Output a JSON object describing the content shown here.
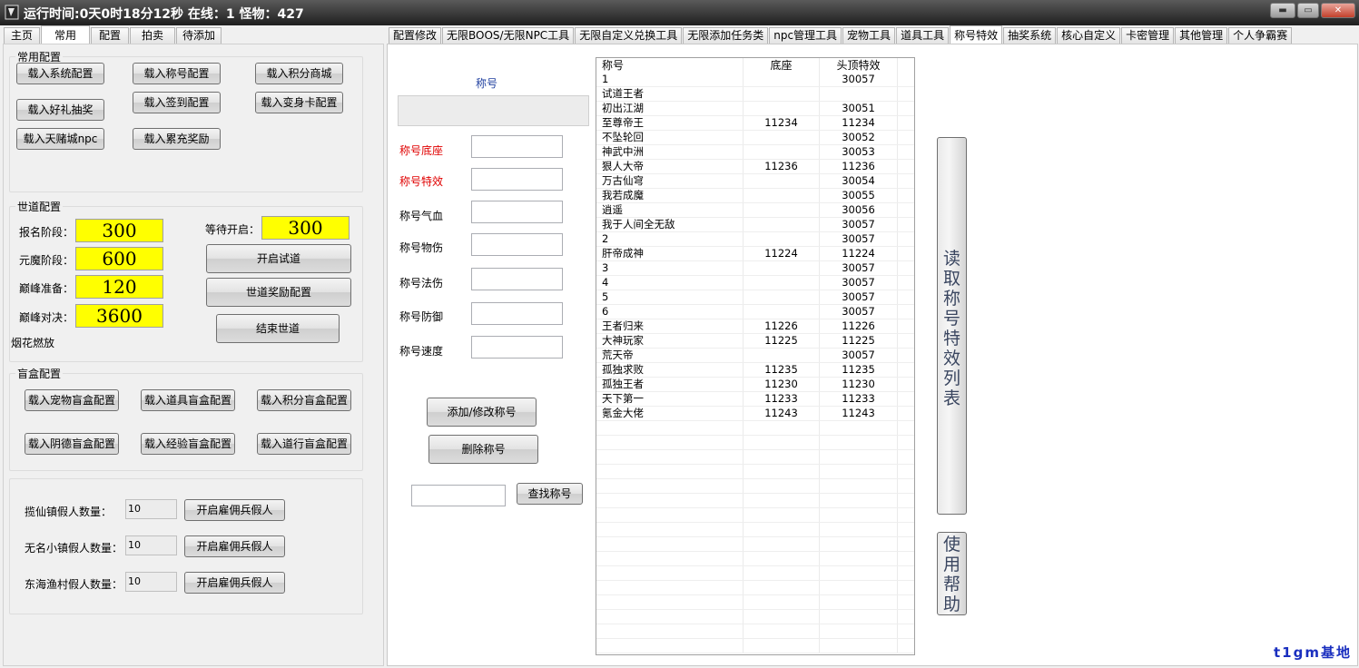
{
  "window": {
    "title": "运行时间:0天0时18分12秒  在线：1  怪物：427",
    "buttons": {
      "minimize": "▬",
      "maximize": "▭",
      "close": "✕"
    }
  },
  "left_tabs": [
    "主页",
    "常用",
    "配置",
    "拍卖",
    "待添加"
  ],
  "right_tabs": [
    "配置修改",
    "无限BOOS/无限NPC工具",
    "无限自定义兑换工具",
    "无限添加任务类",
    "npc管理工具",
    "宠物工具",
    "道具工具",
    "称号特效",
    "抽奖系统",
    "核心自定义",
    "卡密管理",
    "其他管理",
    "个人争霸赛"
  ],
  "common_config": {
    "title": "常用配置",
    "buttons": [
      "载入系统配置",
      "载入称号配置",
      "载入积分商城",
      "载入好礼抽奖",
      "载入签到配置",
      "载入变身卡配置",
      "载入天赌城npc",
      "载入累充奖励"
    ]
  },
  "world_config": {
    "title": "世道配置",
    "signup_label": "报名阶段：",
    "signup_value": "300",
    "demon_label": "元魔阶段：",
    "demon_value": "600",
    "peak_prep_label": "巅峰准备：",
    "peak_prep_value": "120",
    "peak_fight_label": "巅峰对决：",
    "peak_fight_value": "3600",
    "wait_label": "等待开启：",
    "wait_value": "300",
    "start_button": "开启试道",
    "reward_button": "世道奖励配置",
    "end_button": "结束世道",
    "fireworks": "烟花燃放"
  },
  "blindbox_config": {
    "title": "盲盒配置",
    "buttons": [
      "载入宠物盲盒配置",
      "载入道具盲盒配置",
      "载入积分盲盒配置",
      "载入阴德盲盒配置",
      "载入经验盲盒配置",
      "载入道行盲盒配置"
    ]
  },
  "fake_players": {
    "rows": [
      {
        "label": "揽仙镇假人数量：",
        "value": "10",
        "button": "开启雇佣兵假人"
      },
      {
        "label": "无名小镇假人数量：",
        "value": "10",
        "button": "开启雇佣兵假人"
      },
      {
        "label": "东海渔村假人数量：",
        "value": "10",
        "button": "开启雇佣兵假人"
      }
    ]
  },
  "title_form": {
    "heading": "称号",
    "base_label": "称号底座",
    "effect_label": "称号特效",
    "hp_label": "称号气血",
    "phys_label": "称号物伤",
    "magic_label": "称号法伤",
    "def_label": "称号防御",
    "speed_label": "称号速度",
    "add_button": "添加/修改称号",
    "delete_button": "删除称号",
    "search_button": "查找称号"
  },
  "title_list": {
    "headers": [
      "称号",
      "底座",
      "头顶特效"
    ],
    "rows": [
      [
        "1",
        "",
        "30057"
      ],
      [
        "试道王者",
        "",
        ""
      ],
      [
        "初出江湖",
        "",
        "30051"
      ],
      [
        "至尊帝王",
        "11234",
        "11234"
      ],
      [
        "不坠轮回",
        "",
        "30052"
      ],
      [
        "神武中洲",
        "",
        "30053"
      ],
      [
        "狠人大帝",
        "11236",
        "11236"
      ],
      [
        "万古仙穹",
        "",
        "30054"
      ],
      [
        "我若成魔",
        "",
        "30055"
      ],
      [
        "逍遥",
        "",
        "30056"
      ],
      [
        "我于人间全无敌",
        "",
        "30057"
      ],
      [
        "2",
        "",
        "30057"
      ],
      [
        "肝帝成神",
        "11224",
        "11224"
      ],
      [
        "3",
        "",
        "30057"
      ],
      [
        "4",
        "",
        "30057"
      ],
      [
        "5",
        "",
        "30057"
      ],
      [
        "6",
        "",
        "30057"
      ],
      [
        "王者归来",
        "11226",
        "11226"
      ],
      [
        "大神玩家",
        "11225",
        "11225"
      ],
      [
        "荒天帝",
        "",
        "30057"
      ],
      [
        "孤独求败",
        "11235",
        "11235"
      ],
      [
        "孤独王者",
        "11230",
        "11230"
      ],
      [
        "天下第一",
        "11233",
        "11233"
      ],
      [
        "氪金大佬",
        "11243",
        "11243"
      ]
    ]
  },
  "side_buttons": {
    "read_list": "读取称号特效列表",
    "help": "使用帮助"
  },
  "brand": "t1gm基地"
}
